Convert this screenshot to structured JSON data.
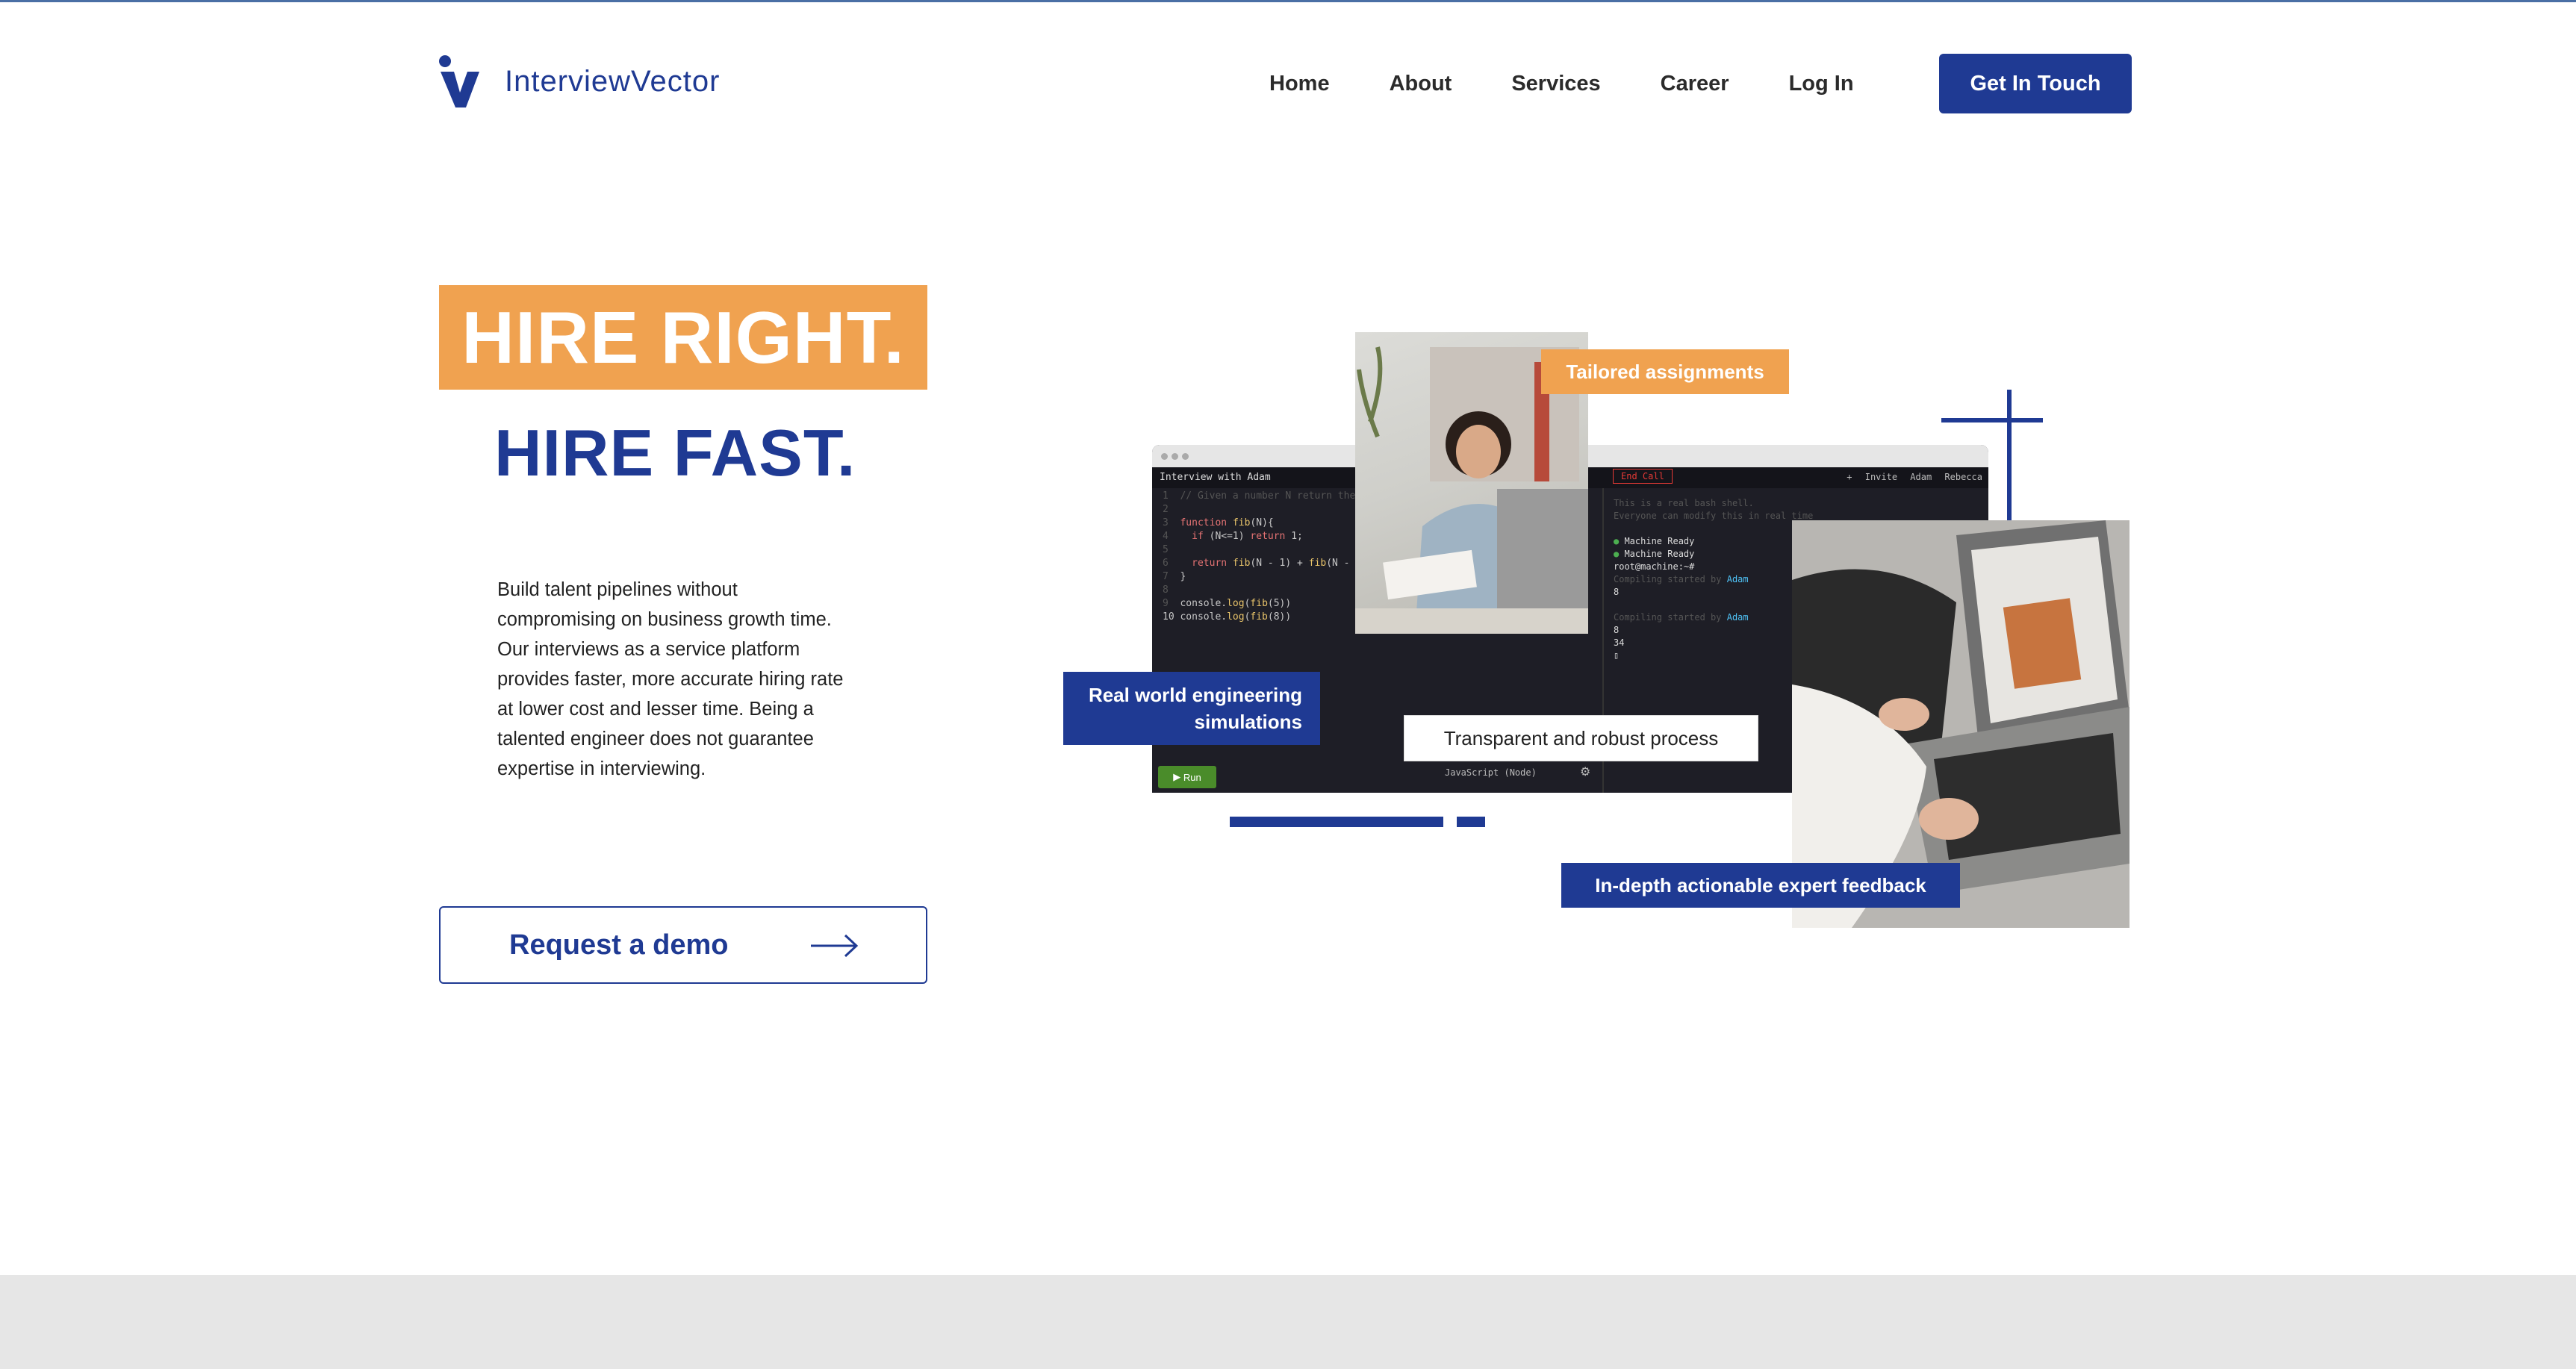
{
  "brand": {
    "name": "InterviewVector",
    "color_primary": "#1f3a93",
    "color_accent": "#f0a250"
  },
  "nav": {
    "items": [
      "Home",
      "About",
      "Services",
      "Career",
      "Log In"
    ],
    "cta": "Get In Touch"
  },
  "hero": {
    "headline_1": "HIRE RIGHT.",
    "headline_2": "HIRE FAST.",
    "description": "Build talent pipelines without compromising on business growth time. Our interviews as a service platform provides faster, more accurate hiring rate at lower cost and lesser time. Being a talented engineer does not guarantee expertise in interviewing.",
    "demo_button": "Request a demo"
  },
  "collage": {
    "tag_tailored": "Tailored assignments",
    "tag_real_world_1": "Real world engineering",
    "tag_real_world_2": "simulations",
    "tag_transparent": "Transparent and robust process",
    "tag_feedback": "In-depth actionable expert feedback",
    "ide": {
      "title": "Interview with Adam",
      "end_call": "End Call",
      "participants": "+ Invite  Adam  Rebecca",
      "run": "Run",
      "language": "JavaScript (Node)"
    }
  }
}
